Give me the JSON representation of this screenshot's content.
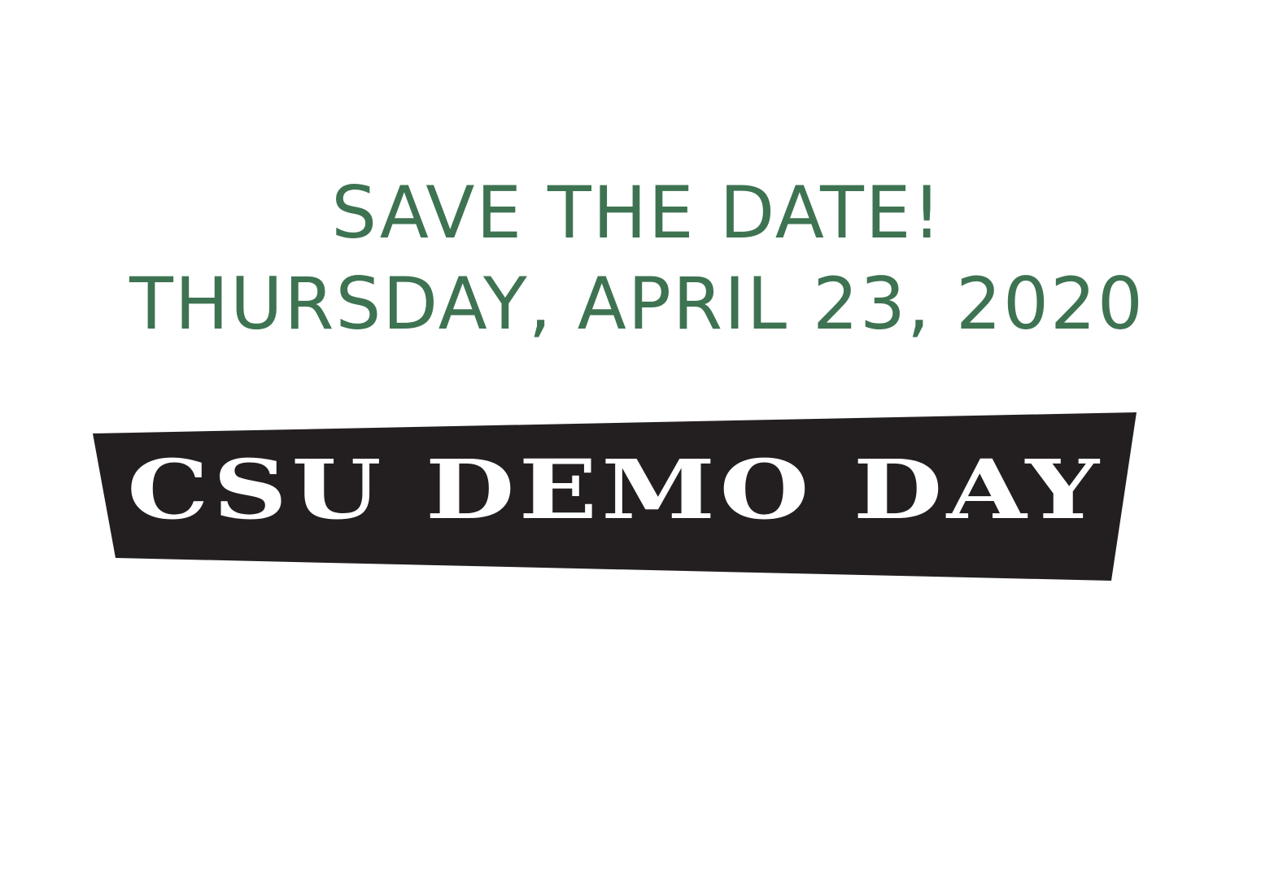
{
  "announcement": {
    "line1": "SAVE THE DATE!",
    "line2": "THURSDAY, APRIL 23, 2020"
  },
  "logo": {
    "text": "CSU DEMO DAY",
    "banner_color": "#231f20",
    "text_color": "#ffffff"
  },
  "colors": {
    "accent": "#3e7352",
    "background": "#ffffff"
  }
}
